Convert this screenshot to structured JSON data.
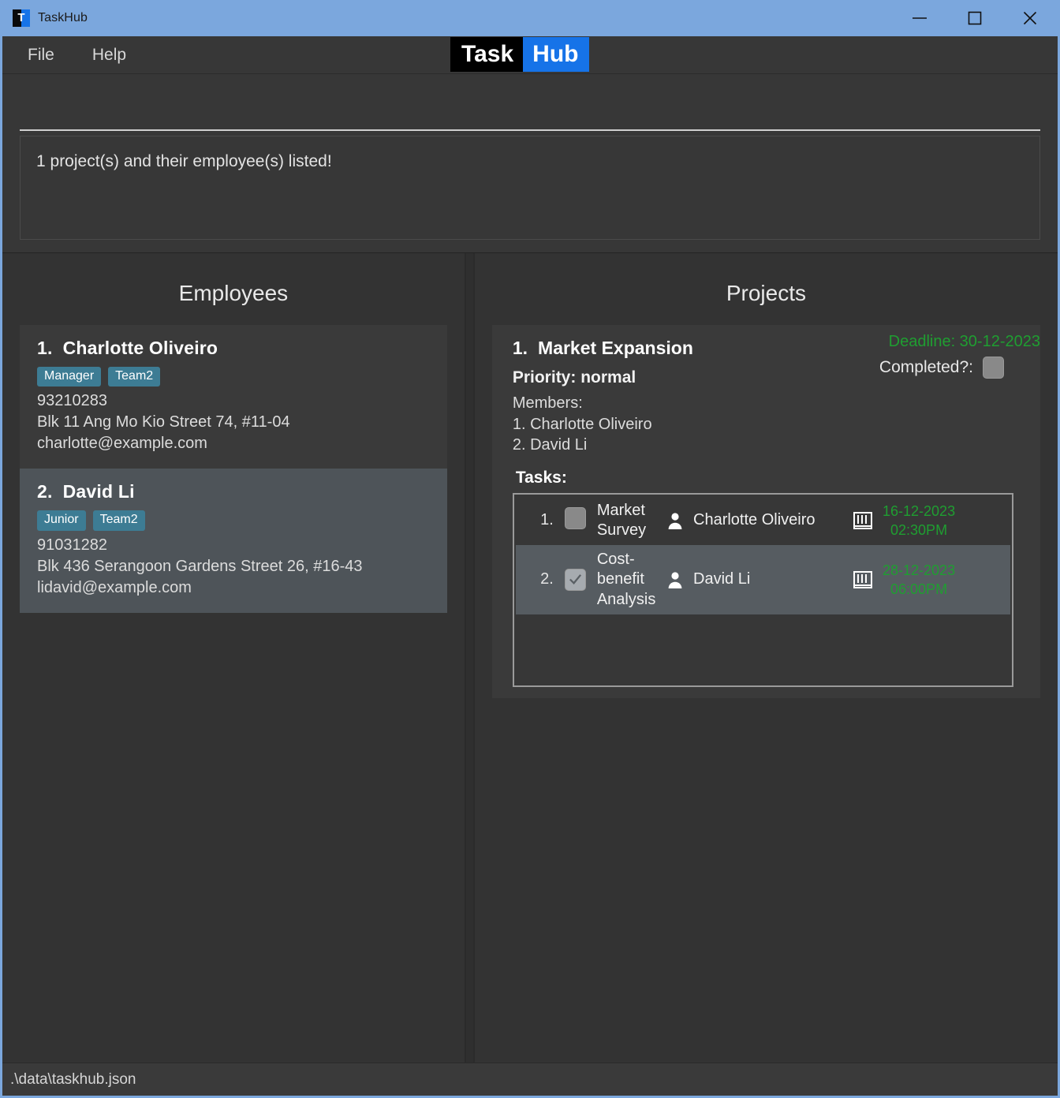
{
  "window": {
    "title": "TaskHub",
    "app_icon": "taskhub-app-icon",
    "minimize": "minimize-icon",
    "maximize": "maximize-icon",
    "close": "close-icon"
  },
  "menu": {
    "items": [
      {
        "label": "File"
      },
      {
        "label": "Help"
      }
    ],
    "logo": {
      "first": "Task",
      "second": "Hub"
    }
  },
  "command": {
    "value": "",
    "placeholder": ""
  },
  "message": {
    "text": "1 project(s) and their employee(s) listed!"
  },
  "employees_panel": {
    "title": "Employees",
    "items": [
      {
        "num": "1.",
        "name": "Charlotte Oliveiro",
        "tags": [
          "Manager",
          "Team2"
        ],
        "phone": "93210283",
        "address": "Blk 11 Ang Mo Kio Street 74, #11-04",
        "email": "charlotte@example.com"
      },
      {
        "num": "2.",
        "name": "David Li",
        "tags": [
          "Junior",
          "Team2"
        ],
        "phone": "91031282",
        "address": "Blk 436 Serangoon Gardens Street 26, #16-43",
        "email": "lidavid@example.com"
      }
    ]
  },
  "projects_panel": {
    "title": "Projects",
    "project": {
      "num": "1.",
      "name": "Market Expansion",
      "priority": "Priority: normal",
      "deadline": "Deadline: 30-12-2023",
      "completed_label": "Completed?:",
      "completed": false,
      "members_label": "Members:",
      "members": [
        "1. Charlotte Oliveiro",
        "2. David Li"
      ],
      "tasks_label": "Tasks:",
      "tasks": [
        {
          "num": "1.",
          "title": "Market Survey",
          "done": false,
          "assignee": "Charlotte Oliveiro",
          "date": "16-12-2023",
          "time": "02:30PM"
        },
        {
          "num": "2.",
          "title": "Cost-benefit Analysis",
          "done": true,
          "assignee": "David Li",
          "date": "28-12-2023",
          "time": "06:00PM"
        }
      ]
    }
  },
  "statusbar": {
    "path": ".\\data\\taskhub.json"
  },
  "colors": {
    "titlebar": "#7ba7dd",
    "accent_blue": "#1673e8",
    "tag_teal": "#3d7c94",
    "green": "#1f9e31",
    "panel": "#333333",
    "card": "#3a3a3a",
    "card_alt": "#4e5459"
  }
}
